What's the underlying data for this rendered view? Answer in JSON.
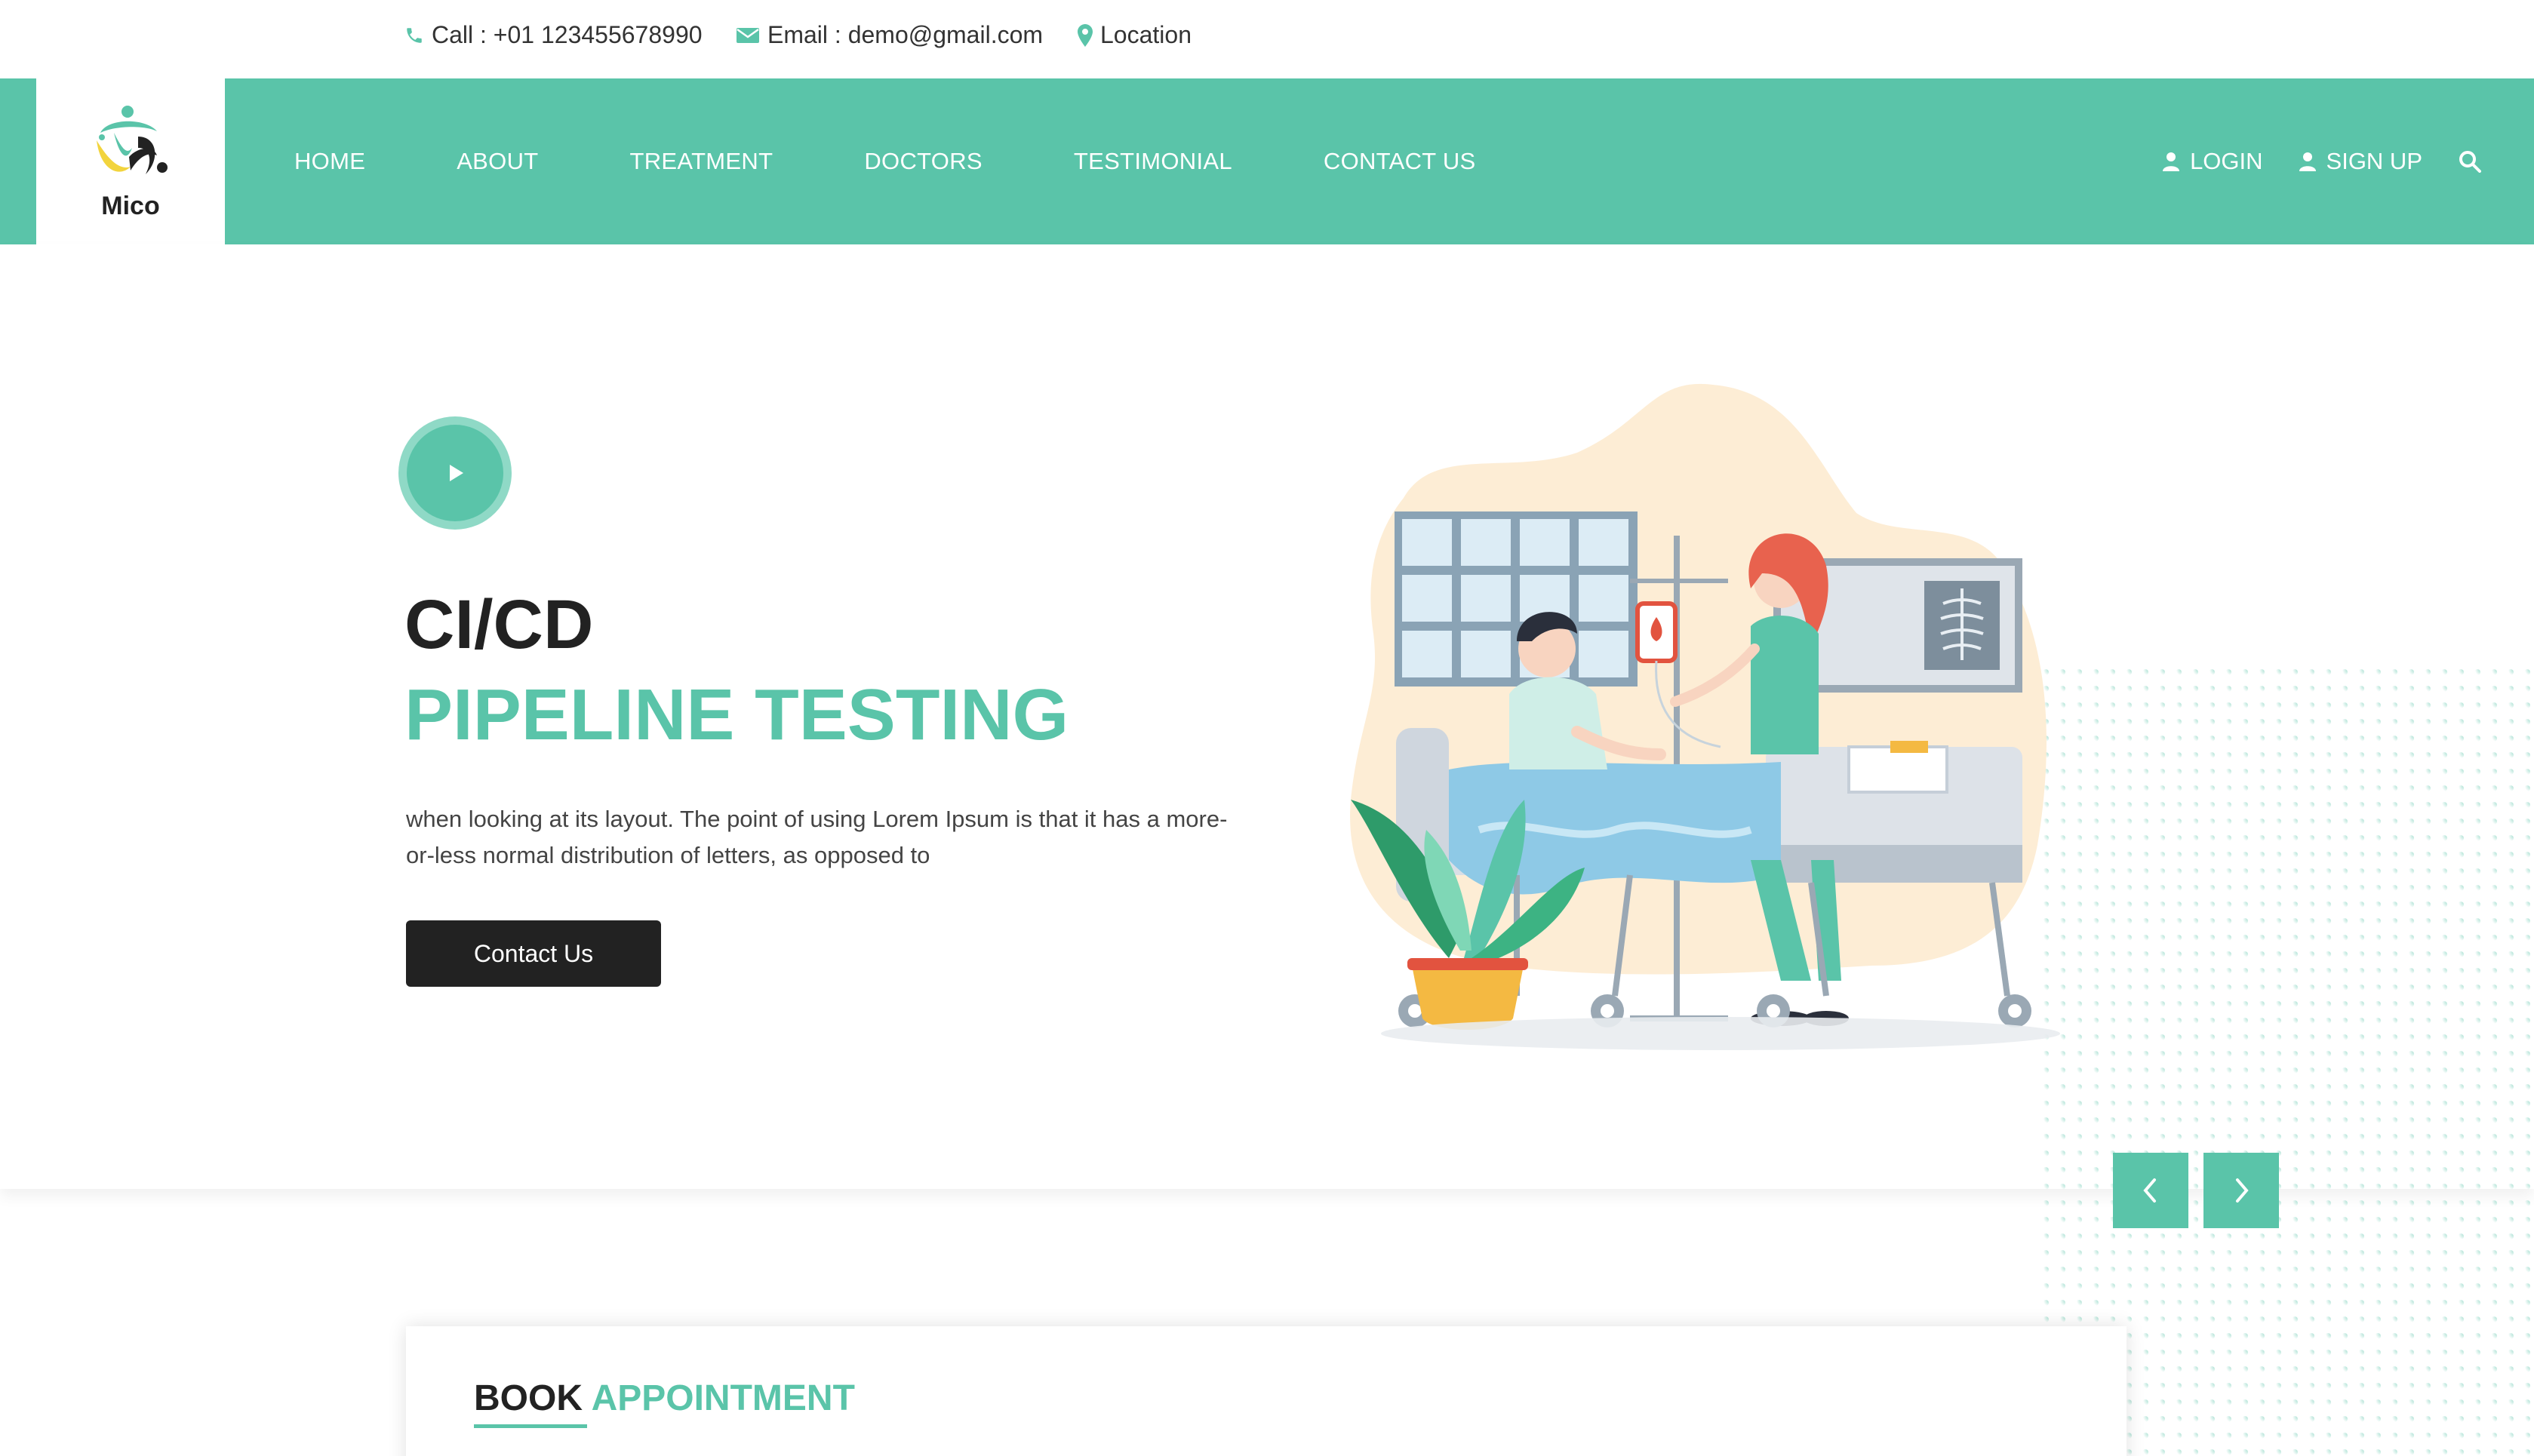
{
  "topbar": {
    "call": "Call : +01 123455678990",
    "email": "Email : demo@gmail.com",
    "location": "Location"
  },
  "brand": {
    "name": "Mico"
  },
  "nav": {
    "items": [
      "HOME",
      "ABOUT",
      "TREATMENT",
      "DOCTORS",
      "TESTIMONIAL",
      "CONTACT US"
    ],
    "login": "LOGIN",
    "signup": "SIGN UP"
  },
  "hero": {
    "title": "CI/CD",
    "subtitle": "PIPELINE TESTING",
    "text": "when looking at its layout. The point of using Lorem Ipsum is that it has a more-or-less normal distribution of letters, as opposed to",
    "button": "Contact Us"
  },
  "book": {
    "title_part1": "BOOK",
    "title_part2": "APPOINTMENT"
  },
  "colors": {
    "accent": "#5ac4a9",
    "dark": "#222222"
  }
}
